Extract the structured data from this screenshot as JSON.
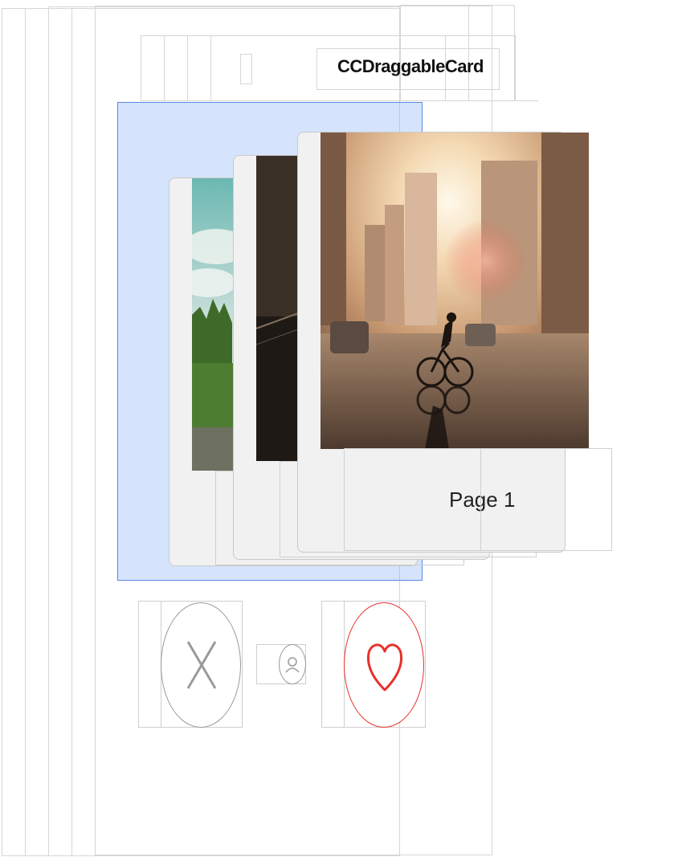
{
  "navigation": {
    "title": "CCDraggableCard"
  },
  "cards": [
    {
      "label": "Page 1",
      "photo": "city-cyclist-sunset-photo"
    },
    {
      "label": "",
      "photo": "dark-street-photo"
    },
    {
      "label": "",
      "photo": "sky-and-trees-photo"
    }
  ],
  "actions": {
    "dislike_icon": "x-icon",
    "profile_icon": "person-icon",
    "like_icon": "heart-icon"
  },
  "colors": {
    "selection_fill": "#7daaf5",
    "selection_border": "#5a88e6",
    "like": "#e8312c",
    "dislike": "#999999"
  }
}
